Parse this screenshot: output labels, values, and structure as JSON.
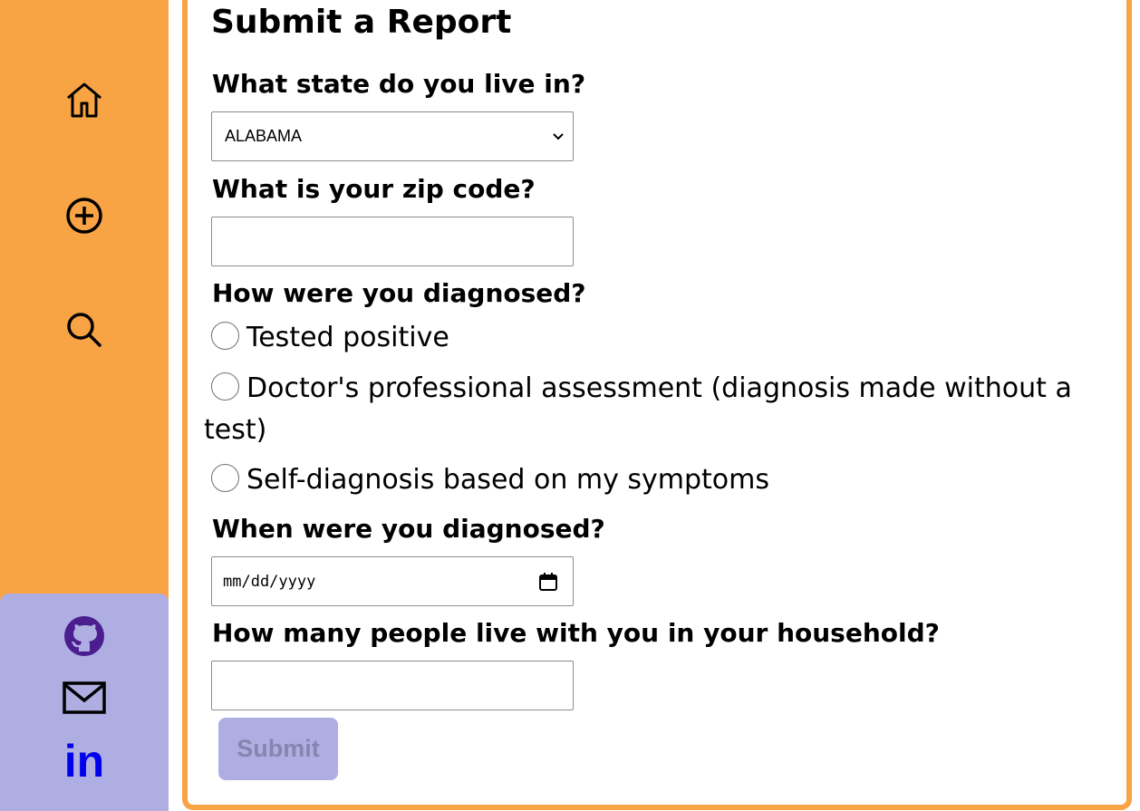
{
  "nav": {
    "icons": [
      "home-icon",
      "add-circle-icon",
      "search-icon"
    ]
  },
  "social": {
    "icons": [
      "github-icon",
      "mail-icon",
      "linkedin-icon"
    ],
    "linkedin_text": "in",
    "github_color": "#4b1d8f",
    "linkedin_color": "#0000ee"
  },
  "colors": {
    "sidebar": "#f9a444",
    "social_panel": "#afaee2",
    "submit_bg": "#afaee2"
  },
  "form": {
    "title": "Submit a Report",
    "state_label": "What state do you live in?",
    "state_value": "ALABAMA",
    "zip_label": "What is your zip code?",
    "zip_value": "",
    "diagnosis_label": "How were you diagnosed?",
    "diagnosis_options": [
      "Tested positive",
      "Doctor's professional assessment (diagnosis made without a",
      "test)",
      "Self-diagnosis based on my symptoms"
    ],
    "date_label": "When were you diagnosed?",
    "date_placeholder": "mm/dd/yyyy",
    "household_label": "How many people live with you in your household?",
    "household_value": "",
    "submit_label": "Submit"
  }
}
